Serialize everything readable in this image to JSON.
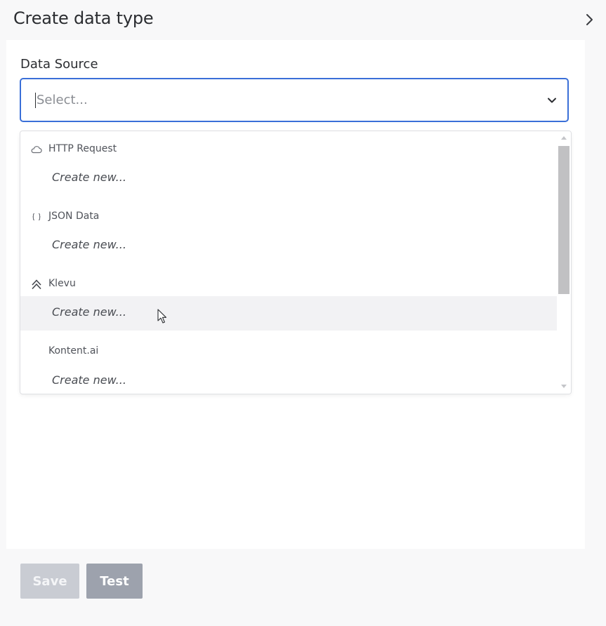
{
  "header": {
    "title": "Create data type",
    "collapse_icon": "chevron-right-icon"
  },
  "form": {
    "data_source_label": "Data Source",
    "select": {
      "placeholder": "Select...",
      "icon": "chevron-down-icon"
    }
  },
  "dropdown": {
    "groups": [
      {
        "label": "HTTP Request",
        "icon": "cloud-icon",
        "option": "Create new..."
      },
      {
        "label": "JSON Data",
        "icon": "braces-icon",
        "option": "Create new..."
      },
      {
        "label": "Klevu",
        "icon": "klevu-logo-icon",
        "option": "Create new..."
      },
      {
        "label": "Kontent.ai",
        "icon": "",
        "option": "Create new..."
      }
    ],
    "hovered_group_index": 2
  },
  "footer": {
    "save_label": "Save",
    "test_label": "Test"
  },
  "colors": {
    "focus_border": "#3a6fd8",
    "test_button": "#9da2ad",
    "save_button_disabled": "#c9ccd3"
  }
}
